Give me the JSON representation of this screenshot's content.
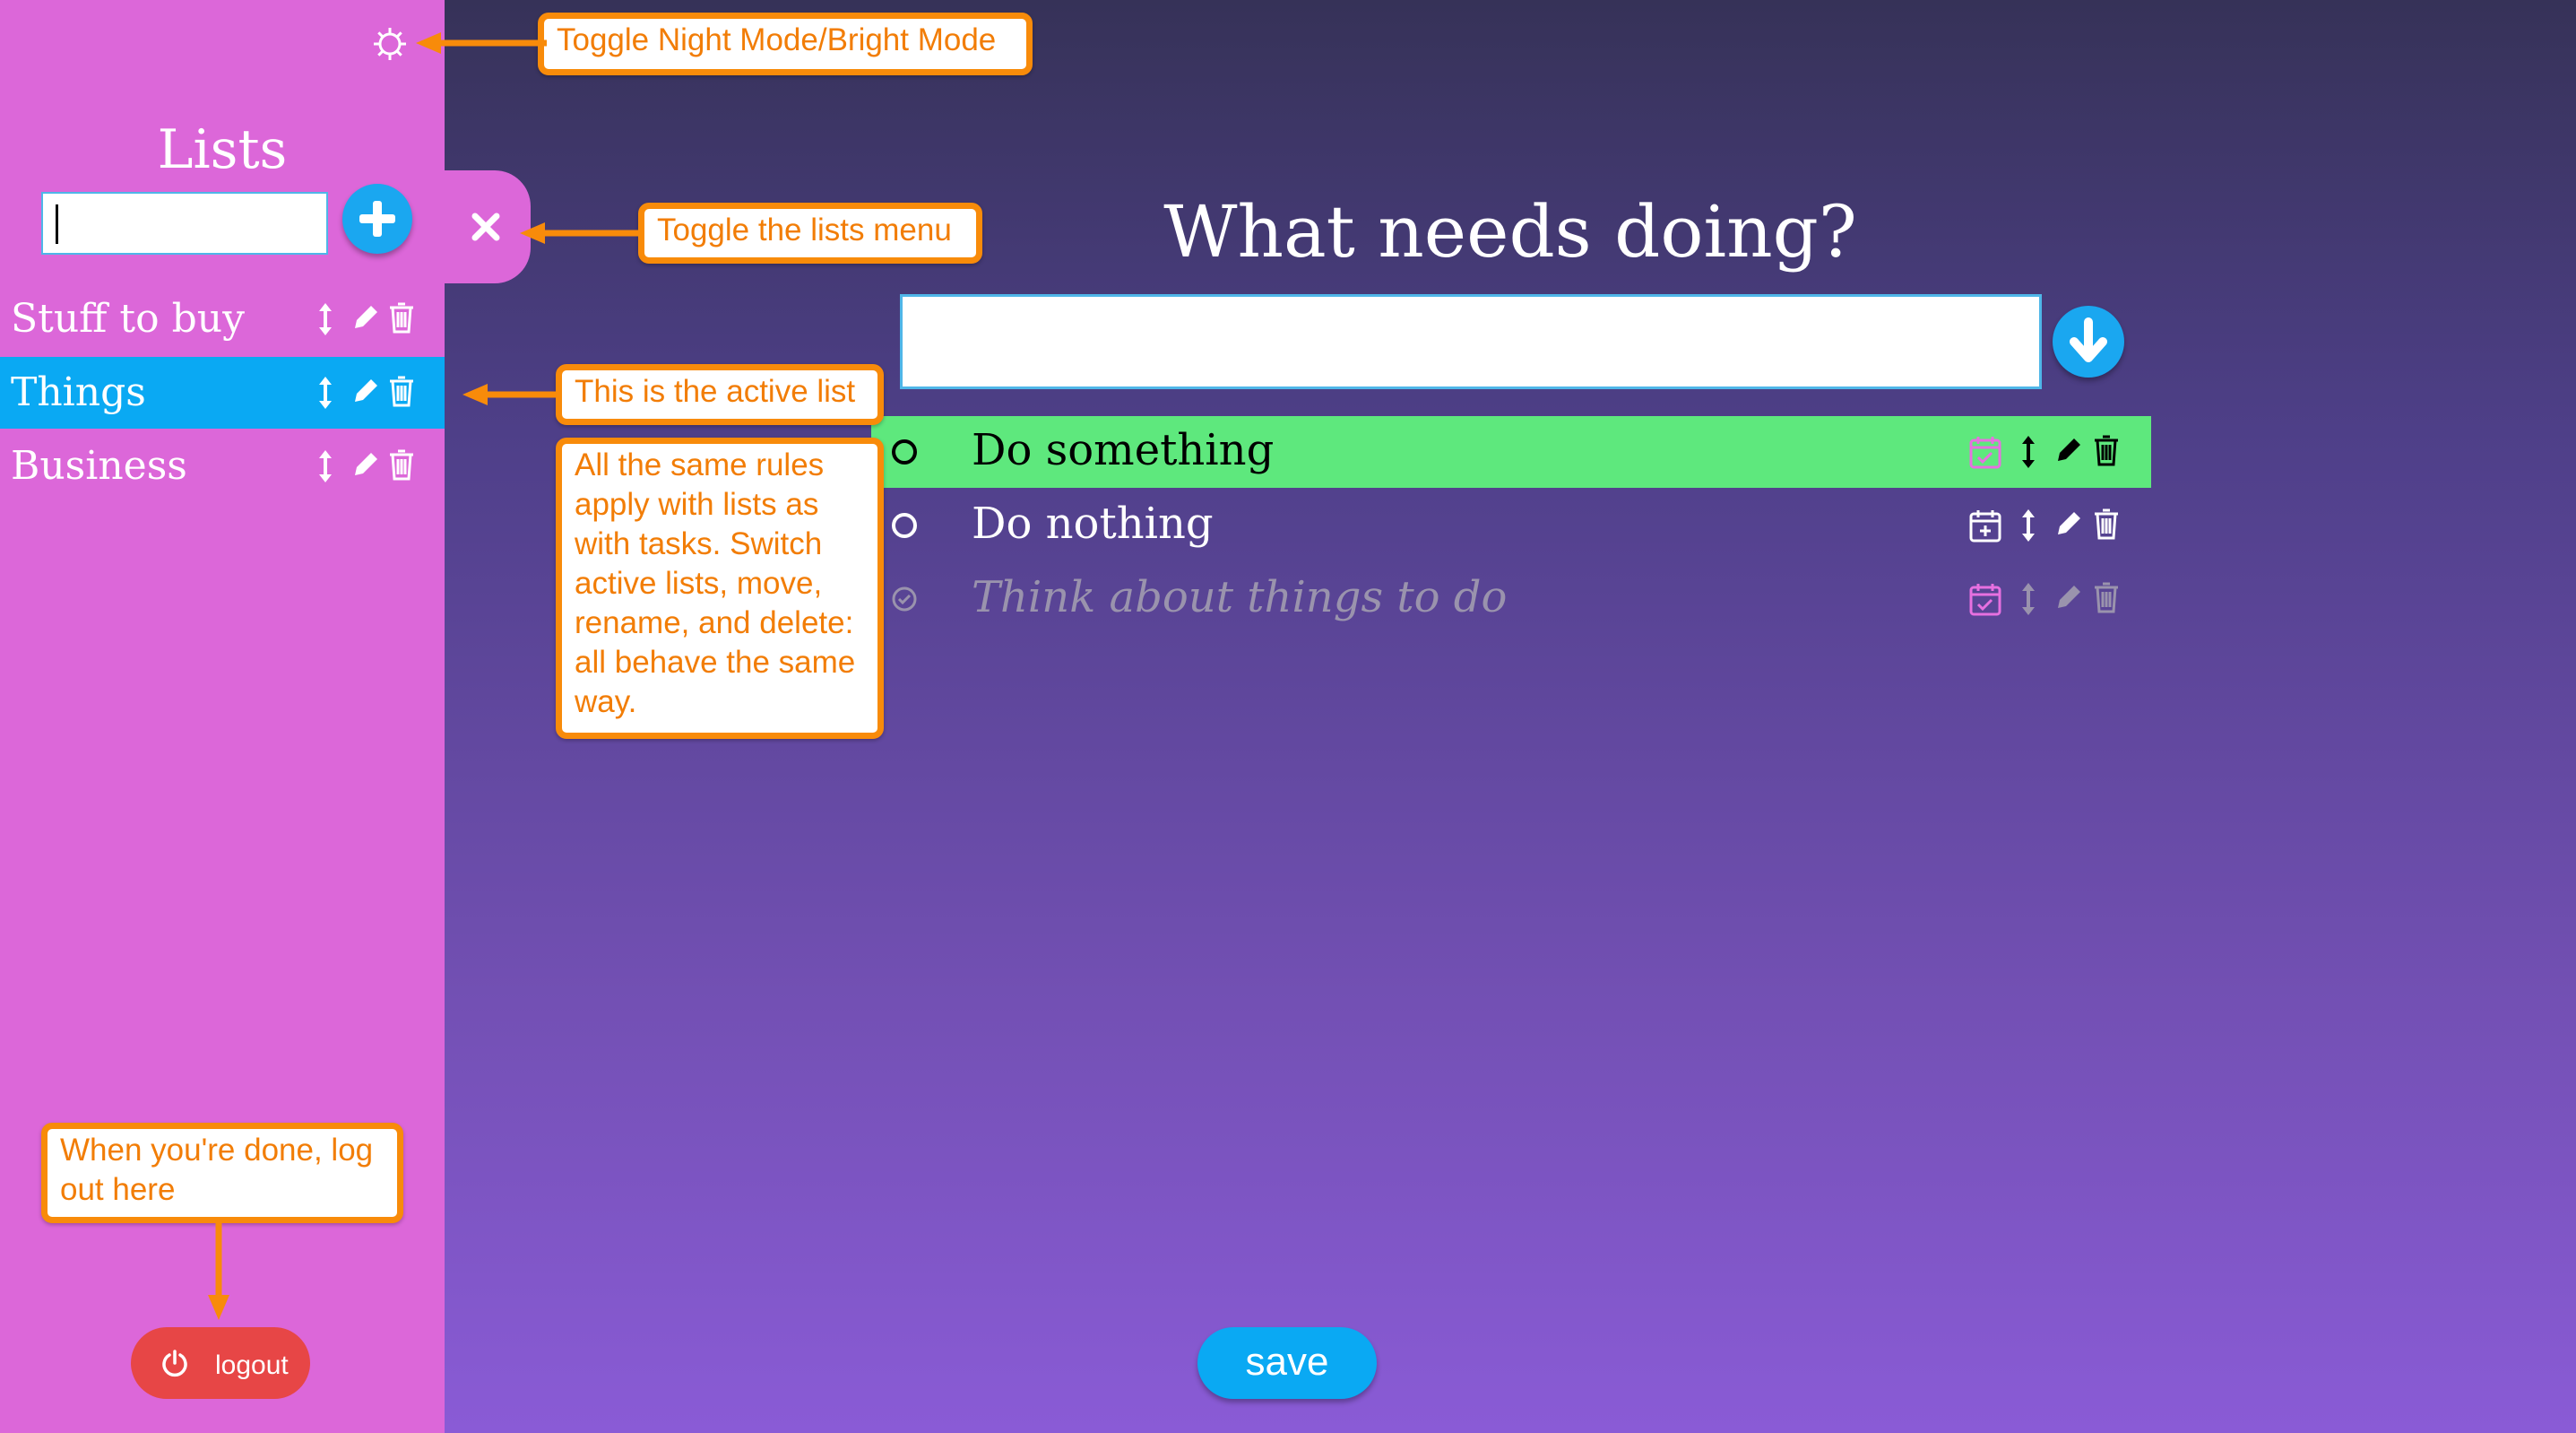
{
  "sidebar": {
    "title": "Lists",
    "new_list_value": "",
    "lists": [
      {
        "name": "Stuff to buy",
        "active": false
      },
      {
        "name": "Things",
        "active": true
      },
      {
        "name": "Business",
        "active": false
      }
    ],
    "logout_label": "logout",
    "icons": {
      "mode_toggle": "gear-icon",
      "add": "plus-icon",
      "close": "close-icon",
      "move": "move-vertical-icon",
      "edit": "pencil-icon",
      "delete": "trash-icon",
      "logout": "power-icon"
    }
  },
  "main": {
    "heading": "What needs doing?",
    "new_task_value": "",
    "tasks": [
      {
        "title": "Do something",
        "done": false,
        "highlighted": true
      },
      {
        "title": "Do nothing",
        "done": false,
        "highlighted": false
      },
      {
        "title": "Think about things to do",
        "done": true,
        "highlighted": false
      }
    ],
    "save_label": "save"
  },
  "annotations": {
    "night_mode": "Toggle Night Mode/Bright Mode",
    "toggle_lists": "Toggle the lists menu",
    "active_list": "This is the active list",
    "same_rules": "All the same rules apply with lists as with tasks. Switch active lists, move, rename, and delete: all behave the same way.",
    "logout_hint": "When you're done, log out here"
  },
  "colors": {
    "sidebar": "#dc67d9",
    "active_list": "#0aa9f3",
    "highlighted_task": "#5ee87d",
    "annotation_border": "#f88b0a",
    "logout_button": "#e74646",
    "save_button": "#0aa9f3"
  }
}
